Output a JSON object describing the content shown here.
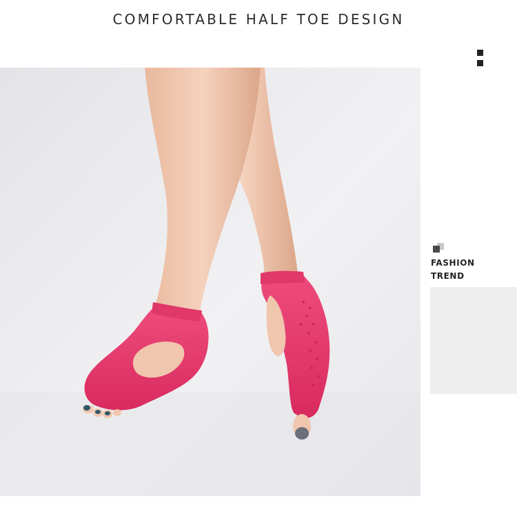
{
  "header": {
    "title": "COMFORTABLE HALF TOE DESIGN"
  },
  "side": {
    "tag_line1": "FASHION",
    "tag_line2": "TREND"
  },
  "photo": {
    "subject": "product-photo-pink-half-toe-socks"
  },
  "colors": {
    "sock": "#e8346a",
    "background": "#ebebed",
    "text": "#2b2b2b",
    "panel": "#eeeeee"
  },
  "icons": [
    "menu-dots-icon",
    "tag-squares-icon"
  ]
}
